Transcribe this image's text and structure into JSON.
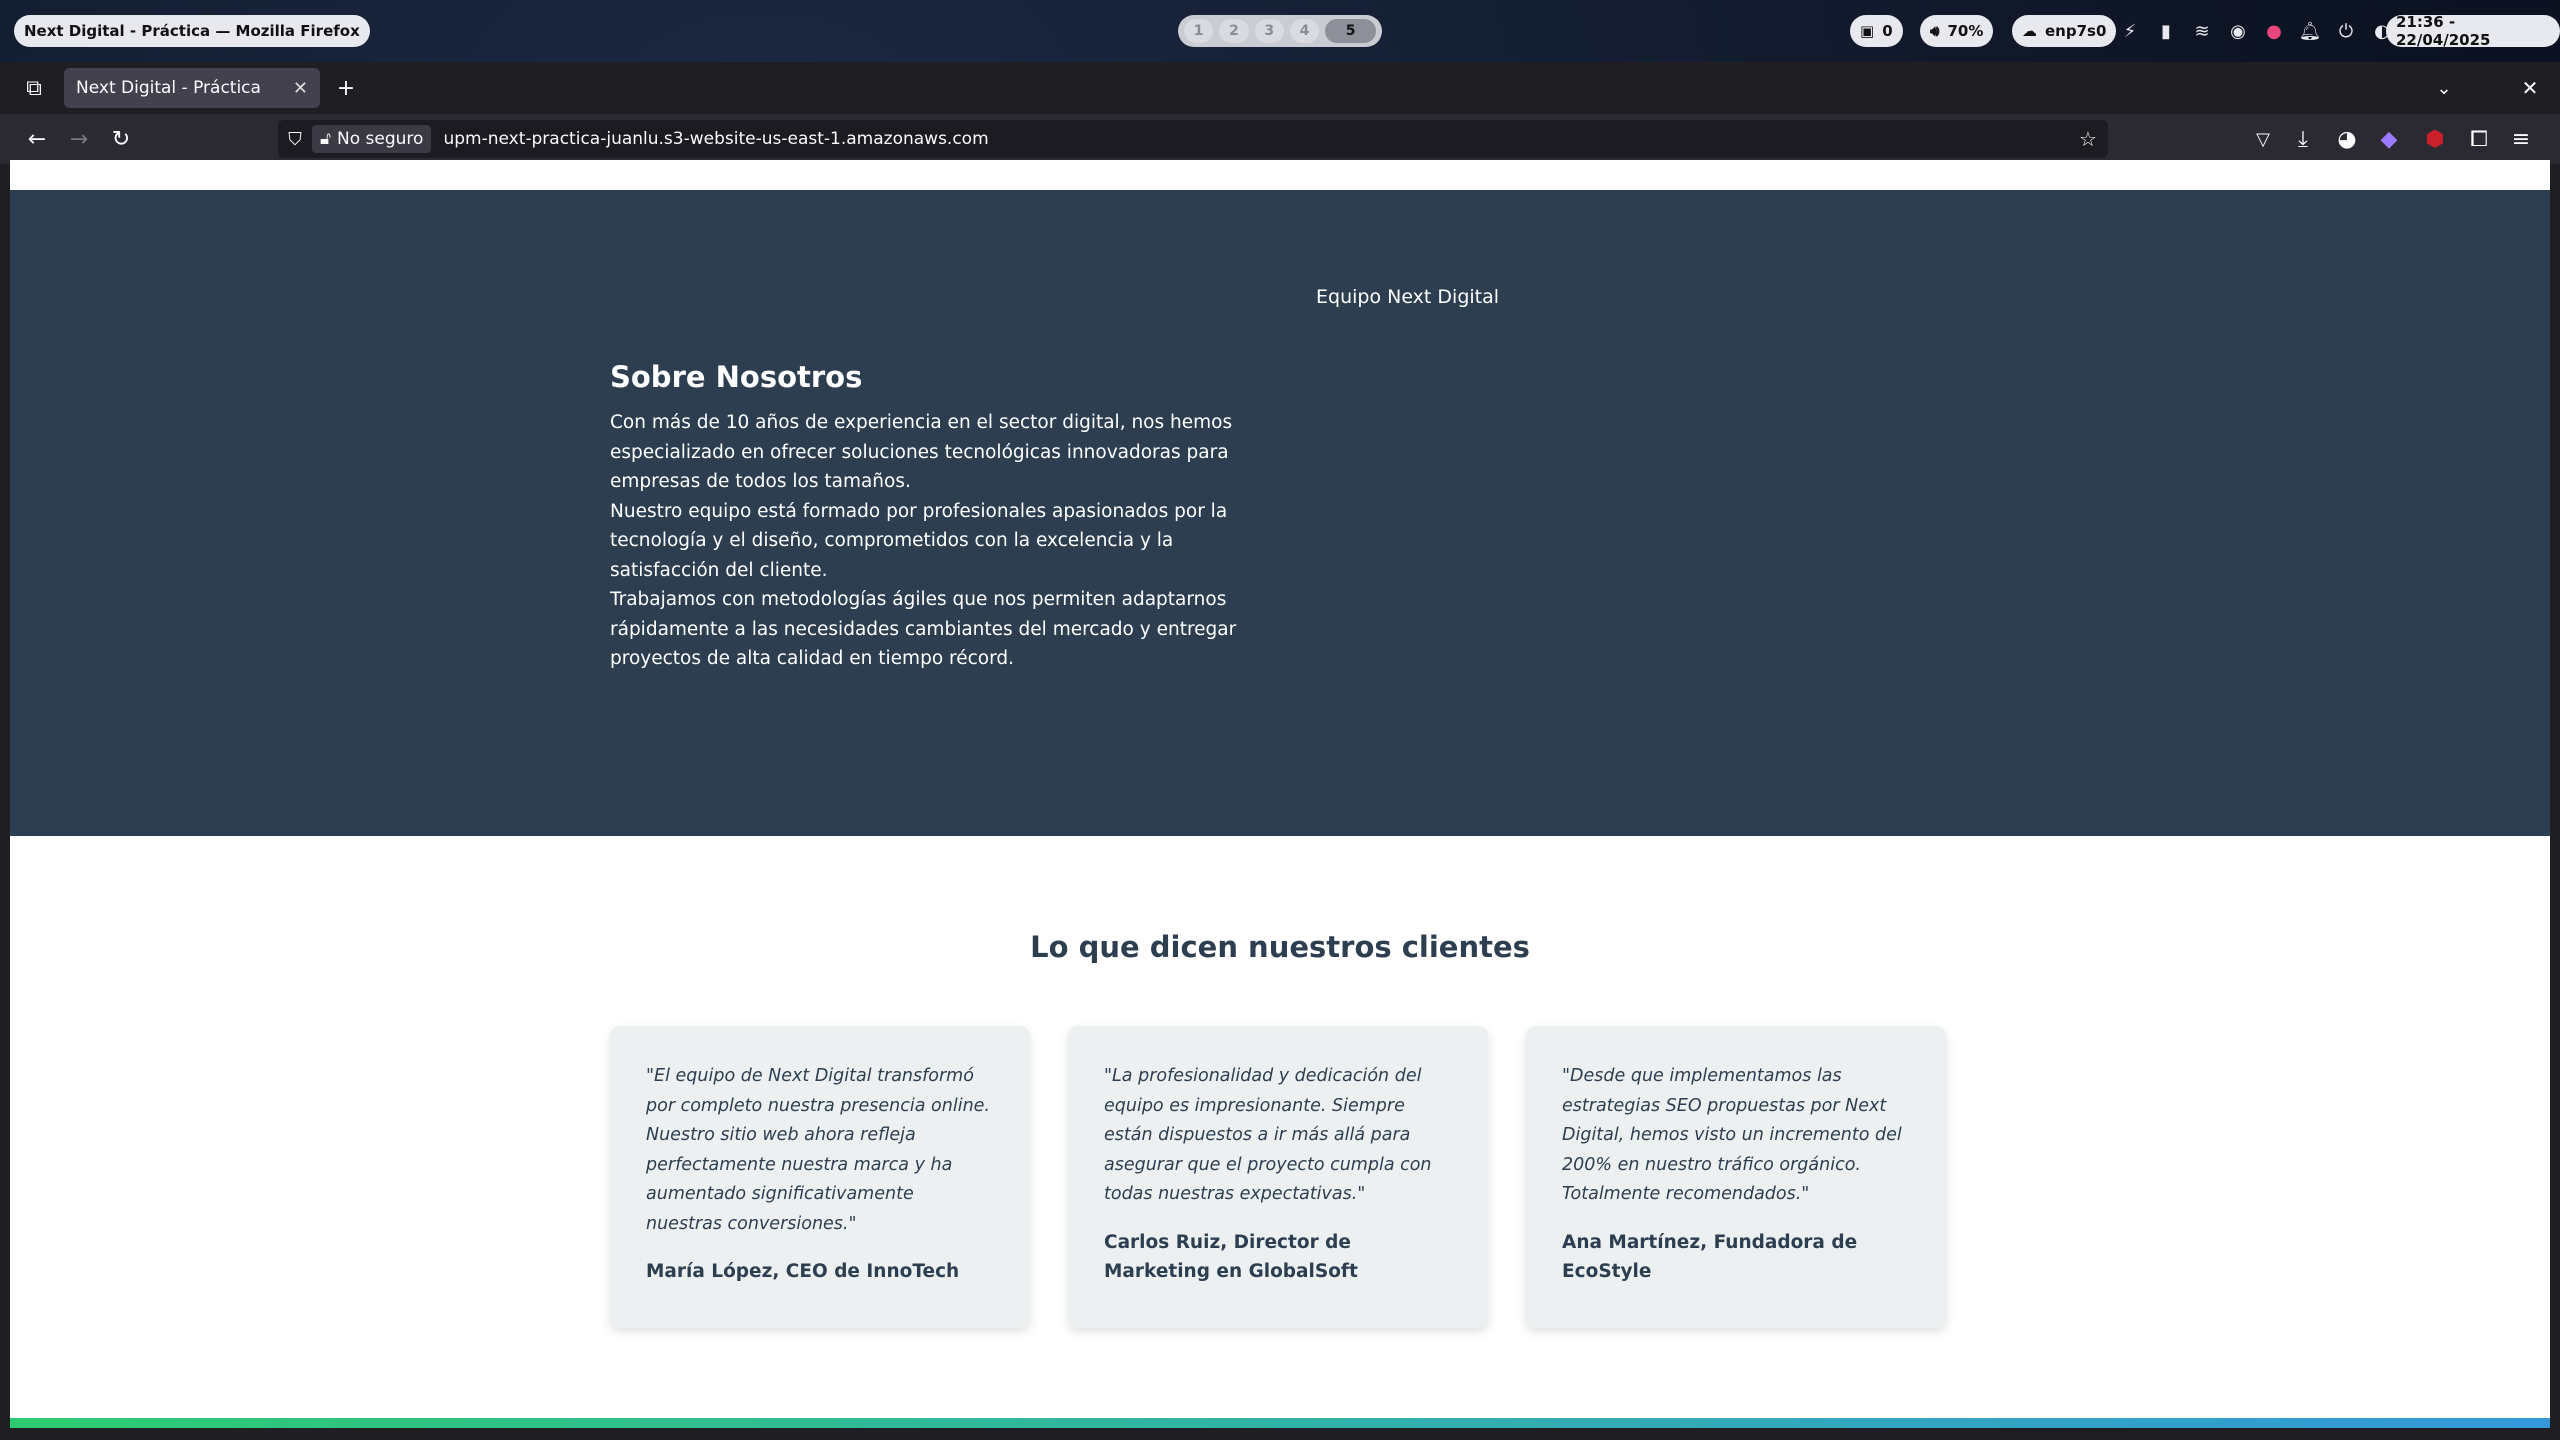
{
  "system_bar": {
    "window_title": "Next Digital - Práctica — Mozilla Firefox",
    "workspaces": [
      "1",
      "2",
      "3",
      "4",
      "5"
    ],
    "active_workspace": "5",
    "notifications": "0",
    "volume": "70%",
    "network": "enp7s0",
    "clock": "21:36 - 22/04/2025"
  },
  "browser": {
    "tab_title": "Next Digital - Práctica",
    "security_label": "No seguro",
    "url": "upm-next-practica-juanlu.s3-website-us-east-1.amazonaws.com"
  },
  "page": {
    "team_caption": "Equipo Next Digital",
    "about": {
      "heading": "Sobre Nosotros",
      "paragraphs": [
        "Con más de 10 años de experiencia en el sector digital, nos hemos especializado en ofrecer soluciones tecnológicas innovadoras para empresas de todos los tamaños.",
        "Nuestro equipo está formado por profesionales apasionados por la tecnología y el diseño, comprometidos con la excelencia y la satisfacción del cliente.",
        "Trabajamos con metodologías ágiles que nos permiten adaptarnos rápidamente a las necesidades cambiantes del mercado y entregar proyectos de alta calidad en tiempo récord."
      ]
    },
    "testimonials": {
      "heading": "Lo que dicen nuestros clientes",
      "items": [
        {
          "quote": "\"El equipo de Next Digital transformó por completo nuestra presencia online. Nuestro sitio web ahora refleja perfectamente nuestra marca y ha aumentado significativamente nuestras conversiones.\"",
          "author": "María López, CEO de InnoTech"
        },
        {
          "quote": "\"La profesionalidad y dedicación del equipo es impresionante. Siempre están dispuestos a ir más allá para asegurar que el proyecto cumpla con todas nuestras expectativas.\"",
          "author": "Carlos Ruiz, Director de Marketing en GlobalSoft"
        },
        {
          "quote": "\"Desde que implementamos las estrategias SEO propuestas por Next Digital, hemos visto un incremento del 200% en nuestro tráfico orgánico. Totalmente recomendados.\"",
          "author": "Ana Martínez, Fundadora de EcoStyle"
        }
      ]
    }
  }
}
